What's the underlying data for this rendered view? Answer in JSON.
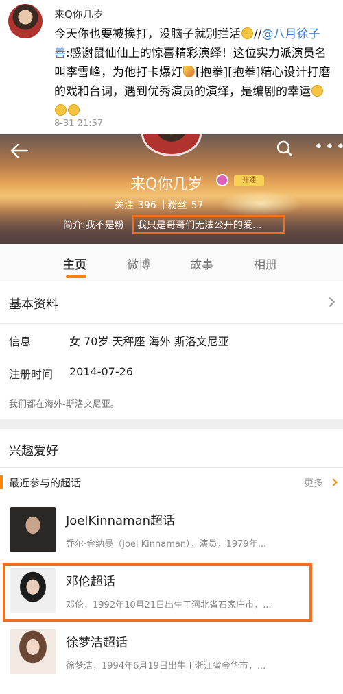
{
  "post": {
    "author": "来Q你几岁",
    "text_part1": "今天你也要被挨打，没脑子就别拦活",
    "text_part2": "//",
    "mention": "@八月徐子善",
    "text_part3": ":感谢鼠仙仙上的惊喜精彩演绎！这位实力派演员名叫李雪峰，为他打卡爆灯",
    "text_part4": "[抱拳][抱拳]精心设计打磨的戏和台词，遇到优秀演员的演绎，是编剧的幸运",
    "time": "8-31 21:57"
  },
  "profile": {
    "name": "来Q你几岁",
    "vip_label": "开通",
    "following_label": "关注",
    "following_count": "396",
    "followers_label": "粉丝",
    "followers_count": "57",
    "intro_prefix": "简介:我不是粉",
    "intro_highlight": "我只是哥哥们无法公开的爱..."
  },
  "tabs": [
    {
      "label": "主页",
      "active": true
    },
    {
      "label": "微博",
      "active": false
    },
    {
      "label": "故事",
      "active": false
    },
    {
      "label": "相册",
      "active": false
    }
  ],
  "basic_info": {
    "title": "基本资料",
    "info_label": "信息",
    "info_value": "女  70岁  天秤座  海外 斯洛文尼亚",
    "reg_label": "注册时间",
    "reg_value": "2014-07-26",
    "note": "我们都在海外-斯洛文尼亚。"
  },
  "interests": {
    "title": "兴趣爱好",
    "sub_title": "最近参与的超话",
    "more_label": "更多",
    "topics": [
      {
        "title": "JoelKinnaman超话",
        "desc": "乔尔·金纳曼（Joel Kinnaman），演员，1979年..."
      },
      {
        "title": "邓伦超话",
        "desc": "邓伦，1992年10月21日出生于河北省石家庄市，..."
      },
      {
        "title": "徐梦洁超话",
        "desc": "徐梦洁，1994年6月19日出生于浙江省金华市，..."
      }
    ]
  },
  "colors": {
    "accent": "#ff8200",
    "link": "#3b7bc8",
    "annotation": "#ef6f1f"
  },
  "icons": [
    "back-arrow-icon",
    "search-icon",
    "more-icon",
    "chevron-right-icon",
    "emoji-icon"
  ]
}
